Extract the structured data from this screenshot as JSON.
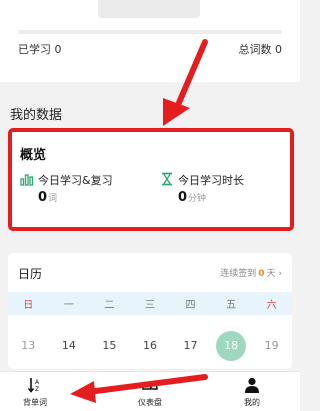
{
  "progress": {
    "learned_label": "已学习 0",
    "total_label": "总词数 0",
    "fraction": 0
  },
  "section": {
    "title": "我的数据"
  },
  "overview": {
    "title": "概览",
    "metrics": [
      {
        "icon": "bar-chart-icon",
        "label": "今日学习&复习",
        "value": "0",
        "unit": "词"
      },
      {
        "icon": "hourglass-icon",
        "label": "今日学习时长",
        "value": "0",
        "unit": "分钟"
      }
    ]
  },
  "calendar": {
    "title": "日历",
    "checkin_prefix": "连续签到",
    "checkin_count": "0",
    "checkin_suffix": "天",
    "chevron": "›",
    "weekdays": [
      "日",
      "一",
      "二",
      "三",
      "四",
      "五",
      "六"
    ],
    "dates": [
      "13",
      "14",
      "15",
      "16",
      "17",
      "18",
      "19"
    ],
    "today": "18"
  },
  "nav": {
    "items": [
      {
        "label": "背单词",
        "icon": "sort-az-icon"
      },
      {
        "label": "仪表盘",
        "icon": "dashboard-icon"
      },
      {
        "label": "我的",
        "icon": "person-icon"
      }
    ]
  },
  "colors": {
    "annotation": "#e41e1e",
    "today_highlight": "#9ed8c0",
    "weekday_band": "#e8f4fc",
    "weekend_red": "#e54545",
    "accent_green": "#2ba86f",
    "checkin_orange": "#f08c2a"
  }
}
